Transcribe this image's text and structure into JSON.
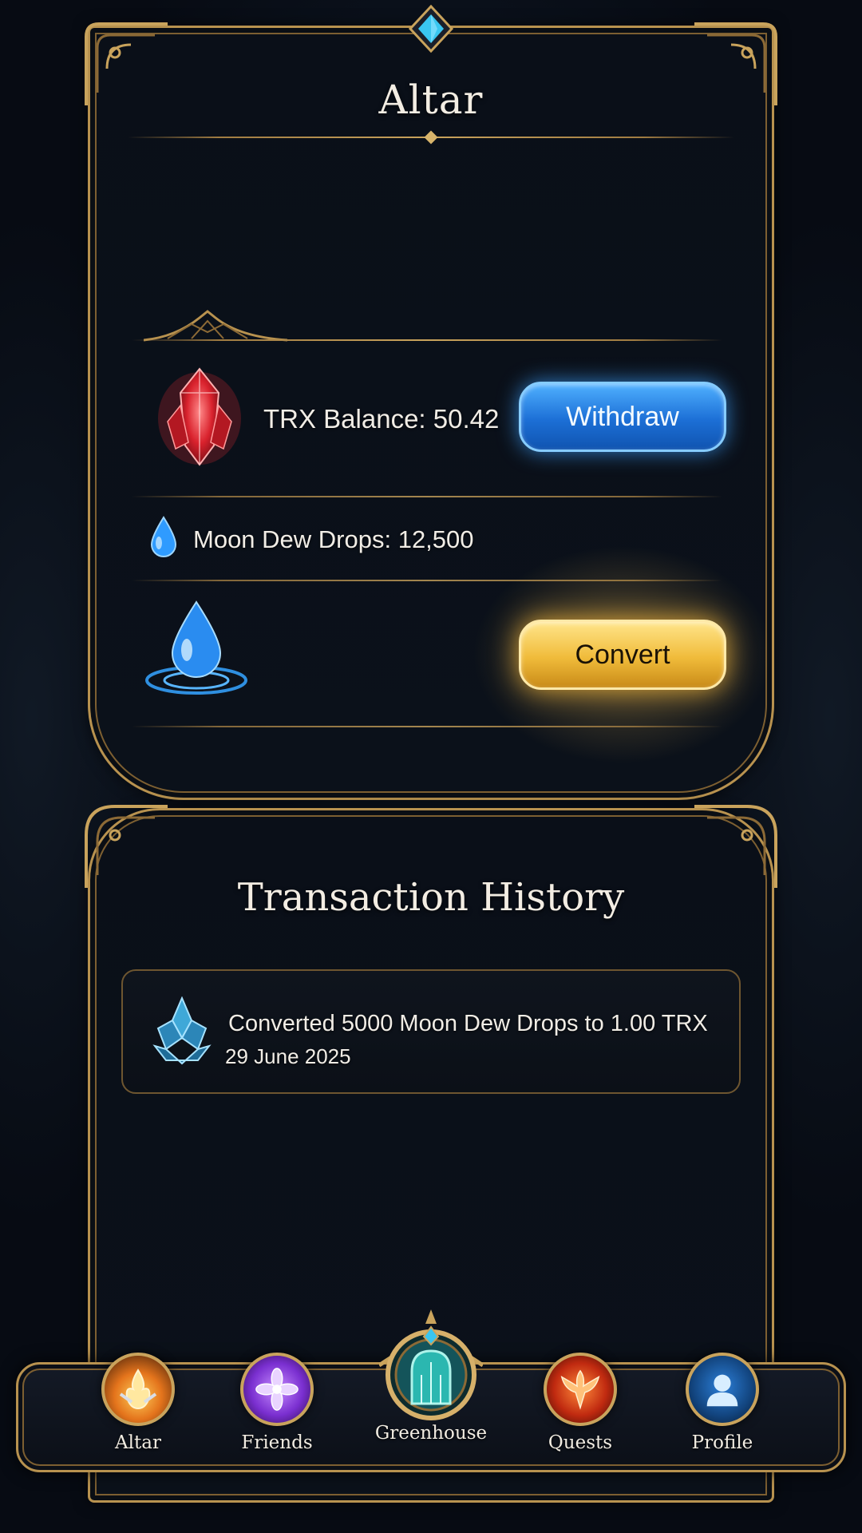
{
  "header": {
    "title": "Altar"
  },
  "wallet": {
    "trx_label": "TRX Balance: 50.42",
    "withdraw_label": "Withdraw",
    "dew_label": "Moon Dew Drops: 12,500",
    "convert_label": "Convert"
  },
  "history": {
    "title": "Transaction History",
    "items": [
      {
        "text": "Converted 5000 Moon Dew Drops to 1.00 TRX",
        "date": "29 June 2025"
      }
    ]
  },
  "nav": {
    "items": [
      {
        "label": "Altar"
      },
      {
        "label": "Friends"
      },
      {
        "label": "Greenhouse"
      },
      {
        "label": "Quests"
      },
      {
        "label": "Profile"
      }
    ]
  },
  "colors": {
    "gold": "#b8924f",
    "withdraw_blue": "#1c6fd6",
    "convert_gold": "#f0bb3a",
    "background": "#070b13"
  },
  "icons": {
    "trx": "red-crystal-icon",
    "dew_small": "water-drop-icon",
    "dew_large": "water-drop-ripple-icon",
    "history_item": "lotus-crystal-icon",
    "nav": [
      "altar-flame-icon",
      "friends-flower-icon",
      "greenhouse-gate-icon",
      "quests-phoenix-icon",
      "profile-user-icon"
    ]
  }
}
